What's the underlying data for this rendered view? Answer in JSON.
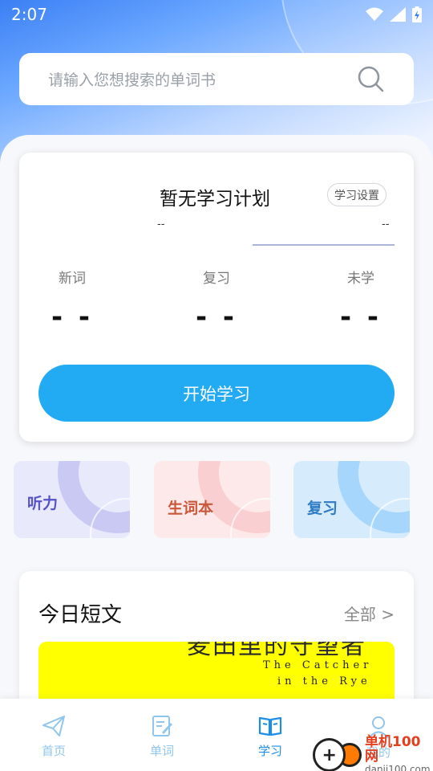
{
  "status_bar": {
    "time": "2:07"
  },
  "search": {
    "placeholder": "请输入您想搜索的单词书"
  },
  "plan": {
    "title": "暂无学习计划",
    "settings_label": "学习设置",
    "progress_left": "--",
    "progress_right": "--",
    "stats": [
      {
        "label": "新词",
        "value": "- -"
      },
      {
        "label": "复习",
        "value": "- -"
      },
      {
        "label": "未学",
        "value": "- -"
      }
    ],
    "start_button": "开始学习"
  },
  "tiles": [
    {
      "label": "听力",
      "color": "#5552c9"
    },
    {
      "label": "生词本",
      "color": "#c9583a"
    },
    {
      "label": "复习",
      "color": "#2f7bc4"
    }
  ],
  "article": {
    "title": "今日短文",
    "all_label": "全部 >",
    "cover_title": "麦田里的守望者",
    "cover_line1": "The Catcher",
    "cover_line2": "in the Rye"
  },
  "nav": {
    "items": [
      {
        "label": "首页",
        "active": false
      },
      {
        "label": "单词",
        "active": false
      },
      {
        "label": "学习",
        "active": true
      },
      {
        "label": "我的",
        "active": false
      }
    ],
    "active_color": "#1d8ee8",
    "inactive_color": "#8fc6ee"
  },
  "watermark": {
    "name": "单机100网",
    "url": "danji100.com"
  }
}
